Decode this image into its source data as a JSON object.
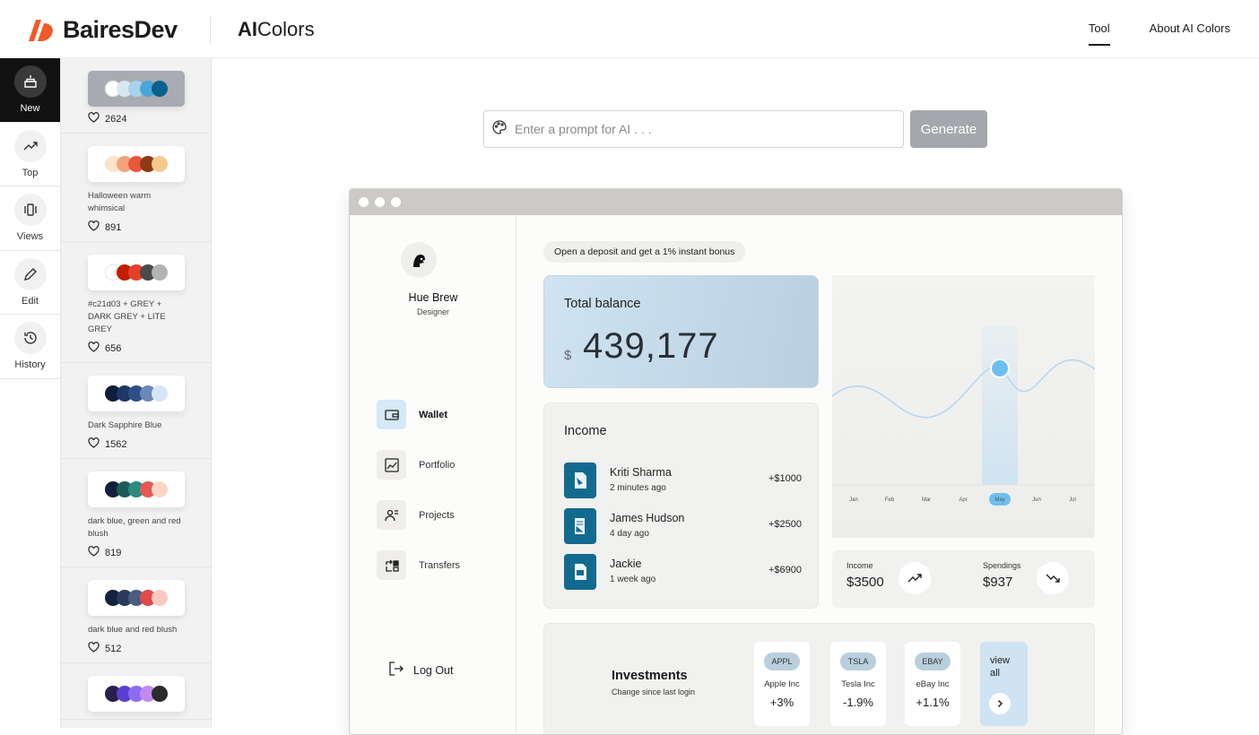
{
  "header": {
    "brand": "BairesDev",
    "product_bold": "AI",
    "product_rest": "Colors",
    "nav": [
      {
        "label": "Tool",
        "active": true
      },
      {
        "label": "About AI Colors",
        "active": false
      }
    ]
  },
  "iconbar": [
    {
      "label": "New",
      "icon": "cake-icon",
      "active": true
    },
    {
      "label": "Top",
      "icon": "trending-up-icon",
      "active": false
    },
    {
      "label": "Views",
      "icon": "carousel-icon",
      "active": false
    },
    {
      "label": "Edit",
      "icon": "pencil-icon",
      "active": false
    },
    {
      "label": "History",
      "icon": "history-icon",
      "active": false
    }
  ],
  "palettes": [
    {
      "name": "",
      "likes": "2624",
      "selected": true,
      "colors": [
        "#ffffff",
        "#d7e7f3",
        "#a8d2ee",
        "#4aa6da",
        "#0d5f8e"
      ]
    },
    {
      "name": "Halloween warm whimsical",
      "likes": "891",
      "colors": [
        "#fde3cb",
        "#f4a27a",
        "#e9573a",
        "#8e3b16",
        "#f6c98f"
      ]
    },
    {
      "name": "#c21d03 + GREY + DARK GREY + LITE GREY",
      "likes": "656",
      "colors": [
        "#ffffff",
        "#c21d03",
        "#e4412b",
        "#4a4a4a",
        "#b3b3b3"
      ]
    },
    {
      "name": "Dark Sapphire Blue",
      "likes": "1562",
      "colors": [
        "#0f1e3a",
        "#1f3766",
        "#2e4f86",
        "#6b89b8",
        "#d5e5f5"
      ]
    },
    {
      "name": "dark blue, green and red blush",
      "likes": "819",
      "colors": [
        "#13223c",
        "#1b5c59",
        "#2a8b7e",
        "#e45a52",
        "#fbd6c5"
      ]
    },
    {
      "name": "dark blue and red blush",
      "likes": "512",
      "colors": [
        "#13223c",
        "#283a5c",
        "#4a5c80",
        "#e04a4a",
        "#f8c9c0"
      ]
    },
    {
      "name": "",
      "likes": "",
      "colors": [
        "#2a1f4a",
        "#5a3fd0",
        "#8e6bf1",
        "#c28af0",
        "#2b2b2b"
      ]
    }
  ],
  "prompt": {
    "placeholder": "Enter a prompt for AI . . .",
    "value": "",
    "button": "Generate"
  },
  "mock": {
    "user": {
      "name": "Hue Brew",
      "role": "Designer"
    },
    "menu": [
      {
        "label": "Wallet",
        "icon": "wallet-icon",
        "active": true
      },
      {
        "label": "Portfolio",
        "icon": "chart-icon",
        "active": false
      },
      {
        "label": "Projects",
        "icon": "users-icon",
        "active": false
      },
      {
        "label": "Transfers",
        "icon": "transfer-icon",
        "active": false
      }
    ],
    "logout": "Log Out",
    "promo": "Open a deposit and get a 1% instant bonus",
    "balance": {
      "title": "Total balance",
      "currency": "$",
      "amount": "439,177"
    },
    "income": {
      "title": "Income",
      "rows": [
        {
          "name": "Kriti Sharma",
          "time": "2 minutes ago",
          "amount": "+$1000"
        },
        {
          "name": "James Hudson",
          "time": "4 day ago",
          "amount": "+$2500"
        },
        {
          "name": "Jackie",
          "time": "1 week ago",
          "amount": "+$6900"
        }
      ]
    },
    "chart": {
      "months": [
        "Jan",
        "Feb",
        "Mar",
        "Apr",
        "May",
        "Jun",
        "Jul"
      ],
      "highlight": "May"
    },
    "stats": {
      "income_label": "Income",
      "income_value": "$3500",
      "spend_label": "Spendings",
      "spend_value": "$937"
    },
    "investments": {
      "title": "Investments",
      "subtitle": "Change since last login",
      "stocks": [
        {
          "ticker": "APPL",
          "name": "Apple Inc",
          "change": "+3%"
        },
        {
          "ticker": "TSLA",
          "name": "Tesla Inc",
          "change": "-1.9%"
        },
        {
          "ticker": "EBAY",
          "name": "eBay Inc",
          "change": "+1.1%"
        }
      ],
      "view_all": "view all"
    }
  }
}
